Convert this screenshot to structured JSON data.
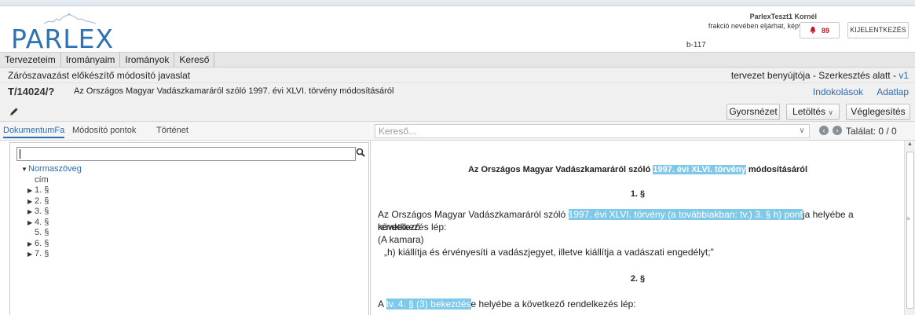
{
  "app": {
    "logo_text": "PARLEX"
  },
  "user": {
    "name": "ParlexTeszt1 Kornél",
    "role": "frakció nevében eljárhat, képviselő",
    "room": "b-117"
  },
  "header": {
    "notification_count": "89",
    "logout_label": "KIJELENTKEZÉS"
  },
  "menu": {
    "items": [
      {
        "label": "Tervezeteim"
      },
      {
        "label": "Irományaim"
      },
      {
        "label": "Irományok"
      },
      {
        "label": "Kereső"
      }
    ]
  },
  "title_row": {
    "left": "Zárószavazást előkészítő módosító javaslat",
    "right_prefix": "tervezet benyújtója - Szerkesztés alatt - ",
    "version": "v1"
  },
  "doc_row": {
    "id": "T/14024/?",
    "title": "Az Országos Magyar Vadászkamaráról szóló 1997. évi XLVI. törvény módosításáról",
    "links": [
      {
        "label": "Indokolások"
      },
      {
        "label": "Adatlap"
      }
    ]
  },
  "toolbar": {
    "preview_label": "Gyorsnézet",
    "download_label": "Letöltés",
    "finalize_label": "Véglegesítés"
  },
  "left_panel": {
    "tabs": [
      {
        "label": "DokumentumFa"
      },
      {
        "label": "Módosító pontok"
      },
      {
        "label": "Történet"
      }
    ],
    "search_value": "",
    "tree_root": "Normaszöveg",
    "tree_items": [
      {
        "label": "cím",
        "expandable": false
      },
      {
        "label": "1. §",
        "expandable": true
      },
      {
        "label": "2. §",
        "expandable": true
      },
      {
        "label": "3. §",
        "expandable": true
      },
      {
        "label": "4. §",
        "expandable": true
      },
      {
        "label": "5. §",
        "expandable": false
      },
      {
        "label": "6. §",
        "expandable": true
      },
      {
        "label": "7. §",
        "expandable": true
      }
    ]
  },
  "right_panel": {
    "search_placeholder": "Kereső...",
    "hits": "Találat: 0 / 0"
  },
  "document": {
    "heading_pre": "Az Országos Magyar Vadászkamaráról szóló ",
    "heading_hl": "1997. évi XLVI. törvény",
    "heading_post": " módosításáról",
    "section1": "1. §",
    "para1_pre": "Az Országos Magyar Vadászkamaráról szóló ",
    "para1_hl": "1997. évi XLVI. törvény (a továbbiakban: tv.) 3. § h) pont",
    "para1_post": "ja helyébe a következő",
    "para1_line2": "rendelkezés lép:",
    "para1_line3": "(A kamara)",
    "para1_line4": "„h) kiállítja és érvényesíti a vadászjegyet, illetve kiállítja a vadászati engedélyt;\"",
    "section2": "2. §",
    "para2_pre": "A ",
    "para2_hl": "tv. 4. § (3) bekezdés",
    "para2_post": "e helyébe a következő rendelkezés lép:"
  },
  "colors": {
    "brand": "#2f72b6",
    "link": "#2b6cb0",
    "highlight": "#7ec8ea",
    "alert": "#c0161d"
  }
}
